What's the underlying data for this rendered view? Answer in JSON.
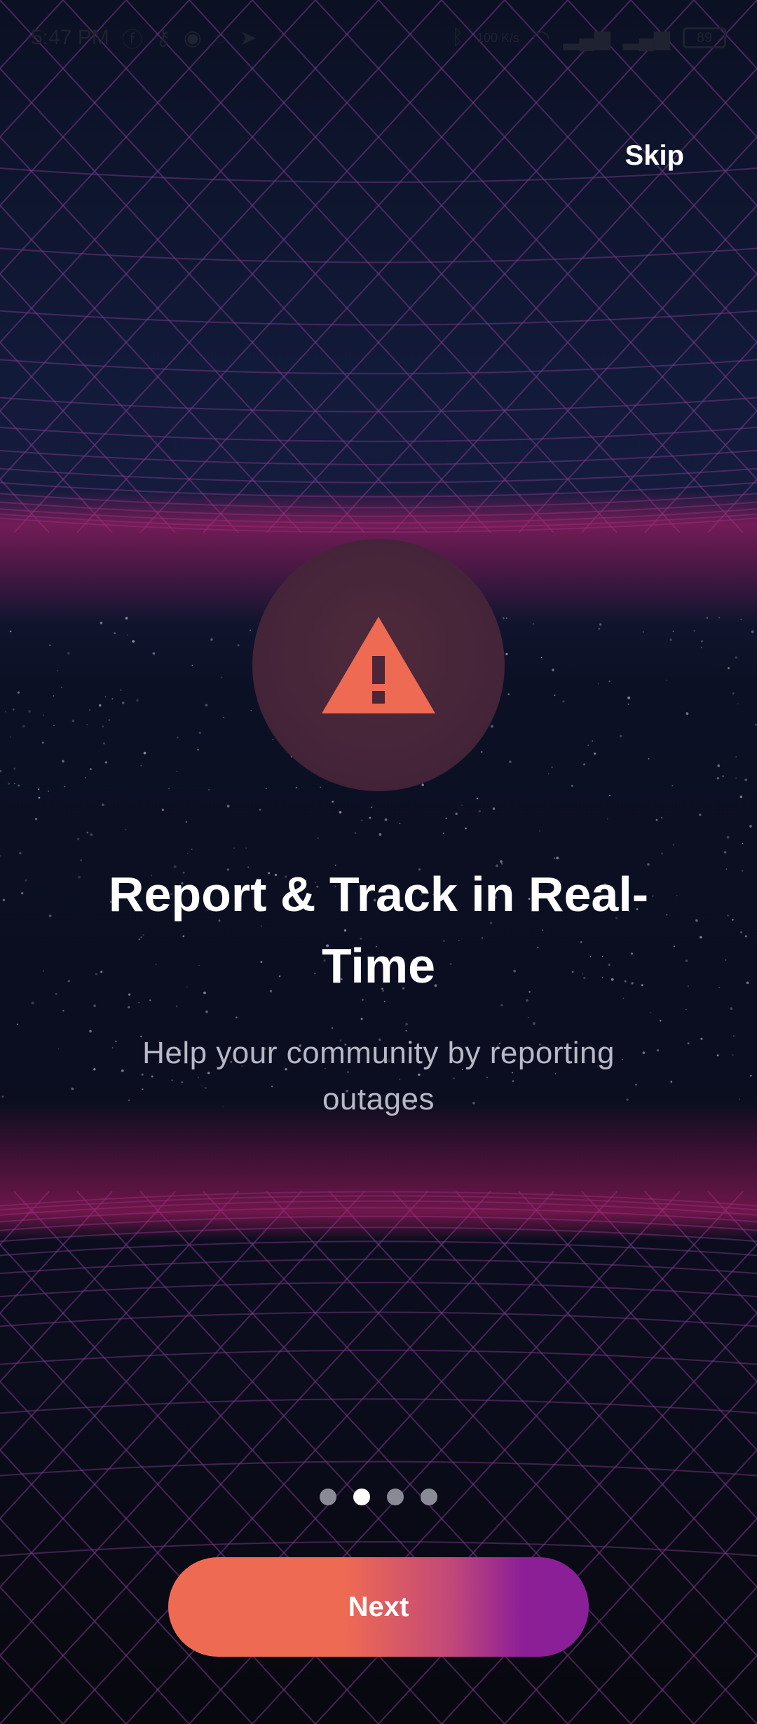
{
  "status_bar": {
    "time": "5:47 PM",
    "network_speed": "100 K/s",
    "battery_level": "89",
    "left_icons": [
      "facebook-icon",
      "vpn-key-icon",
      "messenger-icon",
      "whatsapp-icon",
      "location-arrow-icon"
    ],
    "right_icons": [
      "bluetooth-icon",
      "wifi-icon",
      "signal-4g-icon",
      "signal-4g-icon"
    ]
  },
  "onboarding": {
    "skip_label": "Skip",
    "hero_icon": "warning-icon",
    "title": "Report & Track in Real-Time",
    "subtitle": "Help your community by reporting outages",
    "page_count": 4,
    "active_page": 2,
    "next_label": "Next"
  },
  "colors": {
    "accent_orange": "#ef6a52",
    "accent_purple": "#8a1f98",
    "grid_line": "#7a3a88",
    "glow_magenta": "#be1e6e",
    "background": "#0b0d1c"
  }
}
